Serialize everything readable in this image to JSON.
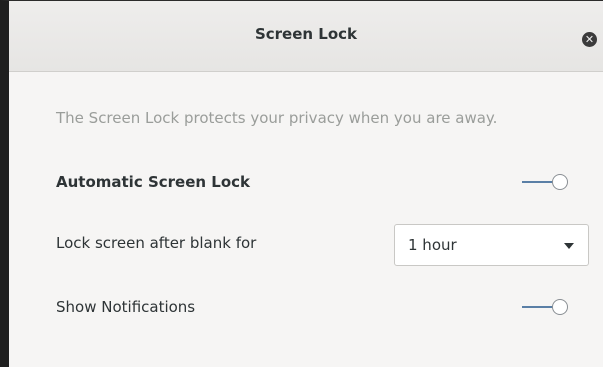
{
  "dialog": {
    "title": "Screen Lock",
    "description": "The Screen Lock protects your privacy when you are away."
  },
  "settings": {
    "automatic_lock": {
      "label": "Automatic Screen Lock",
      "enabled": true
    },
    "lock_after": {
      "label": "Lock screen after blank for",
      "selected": "1 hour"
    },
    "notifications": {
      "label": "Show Notifications",
      "enabled": true
    }
  },
  "icons": {
    "close": "close-icon",
    "dropdown": "chevron-down-icon"
  },
  "colors": {
    "accent": "#5a7fa6",
    "description_text": "#9a9d9a",
    "label_text": "#2e3436"
  }
}
